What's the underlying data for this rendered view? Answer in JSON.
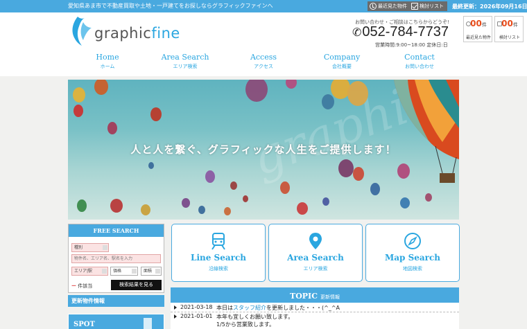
{
  "topbar": {
    "tagline": "愛知県あま市で不動産買取や土地・一戸建てをお探しならグラフィックファインへ",
    "recent_label": "最近見た物件",
    "checklist_label": "検討リスト",
    "updated": "最終更新：2026年09月16日"
  },
  "header": {
    "logo_text_a": "graphic",
    "logo_text_b": "fine",
    "contact_note": "お問い合わせ・ご相談はこちらからどうぞ!",
    "phone": "052-784-7737",
    "hours": "営業時間:9:00~18:00 定休日:日",
    "counters": [
      {
        "num": "00",
        "unit": "件",
        "caption": "最近見た物件"
      },
      {
        "num": "00",
        "unit": "件",
        "caption": "検討リスト"
      }
    ]
  },
  "nav": [
    {
      "en": "Home",
      "jp": "ホーム"
    },
    {
      "en": "Area Search",
      "jp": "エリア検索"
    },
    {
      "en": "Access",
      "jp": "アクセス"
    },
    {
      "en": "Company",
      "jp": "会社概要"
    },
    {
      "en": "Contact",
      "jp": "お問い合わせ"
    }
  ],
  "hero": {
    "catchphrase": "人と人を繋ぐ、グラフィックな人生をご提供します！",
    "watermark": "graphicfine"
  },
  "free_search": {
    "title": "FREE SEARCH",
    "type_select": "種別",
    "keyword_placeholder": "物件名、エリア名、駅名を入力",
    "area_select": "エリア|駅",
    "price_select": "価格",
    "size_select": "面積",
    "count_value": "ー",
    "count_label": "件該当",
    "submit": "検索結果を見る"
  },
  "sidebar": {
    "new_info": "更新物件情報",
    "spot": "SPOT"
  },
  "cards": [
    {
      "title": "Line Search",
      "sub": "沿線検索",
      "icon": "train-icon"
    },
    {
      "title": "Area Search",
      "sub": "エリア検索",
      "icon": "map-pin-icon"
    },
    {
      "title": "Map Search",
      "sub": "地図検索",
      "icon": "compass-icon"
    }
  ],
  "topic": {
    "title": "TOPIC",
    "subtitle": "更新情報",
    "items": [
      {
        "date": "2021-03-18",
        "pre": "本日は",
        "link": "スタッフ紹介",
        "post": "を更新しました・・・(^_^A"
      },
      {
        "date": "2021-01-01",
        "text1": "本年も宜しくお願い致します。",
        "text2": "1/5から営業致します。"
      }
    ]
  },
  "colors": {
    "accent": "#49a9df",
    "brand": "#2aa6e0",
    "counter": "#e74c1b"
  }
}
